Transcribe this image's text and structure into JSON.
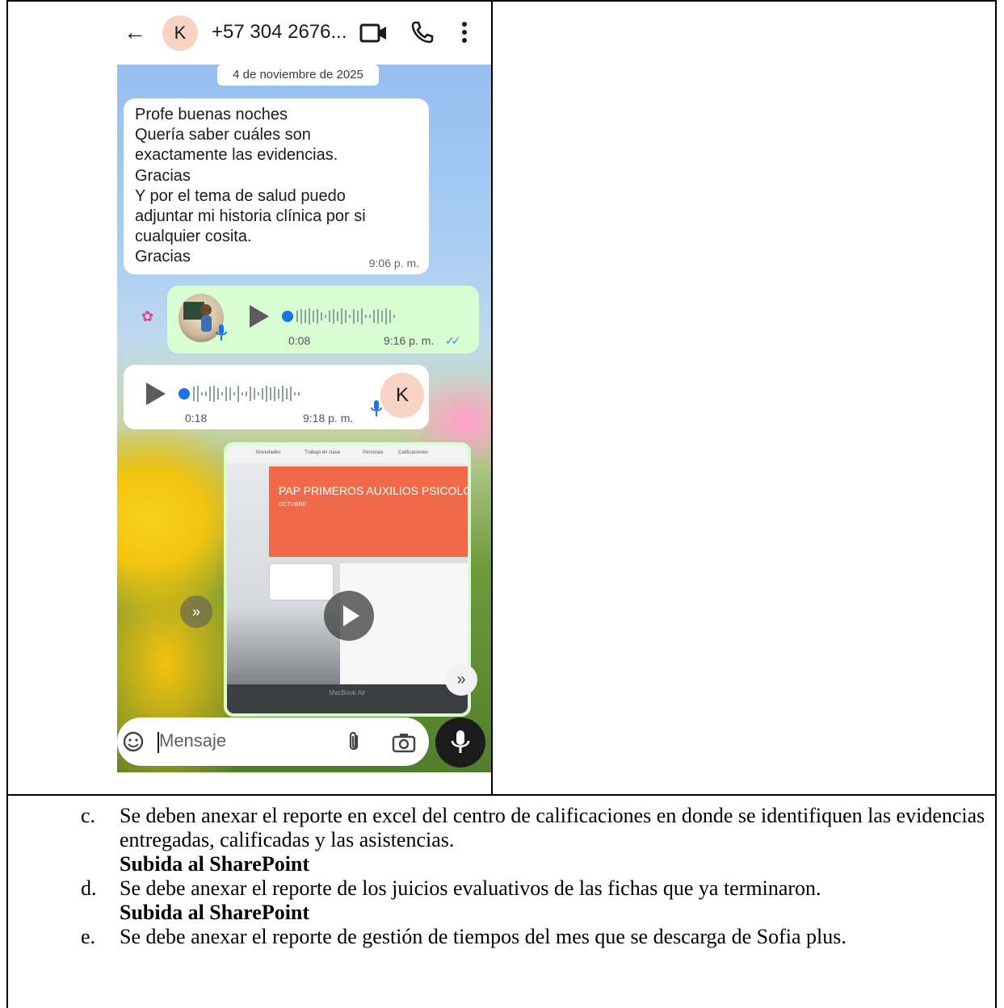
{
  "phone": {
    "header": {
      "avatar_letter": "K",
      "contact": "+57 304 2676...",
      "icons": [
        "back-arrow-icon",
        "video-call-icon",
        "phone-call-icon",
        "more-vert-icon"
      ]
    },
    "date_chip": "4 de noviembre de 2025",
    "message_in": {
      "lines": [
        "Profe buenas noches",
        "Quería saber cuáles son",
        "exactamente las evidencias.",
        "Gracias",
        "Y por el tema de salud puedo",
        "adjuntar mi historia clínica por si",
        "cualquier cosita.",
        "Gracias"
      ],
      "time": "9:06 p. m."
    },
    "audio_out": {
      "duration": "0:08",
      "time": "9:16 p. m.",
      "ticks": "✓✓"
    },
    "audio_in": {
      "duration": "0:18",
      "time": "9:18 p. m.",
      "avatar_letter": "K"
    },
    "video": {
      "tabs": [
        "Novedades",
        "Trabajo en clase",
        "Personas",
        "Calificaciones"
      ],
      "banner_title": "PAP PRIMEROS AUXILIOS PSICOLO",
      "banner_sub": "OCTUBRE",
      "laptop_label": "MacBook Air"
    },
    "composer": {
      "placeholder": "Mensaje"
    },
    "colors": {
      "outgoing_bubble": "#d9fdd3",
      "incoming_bubble": "#ffffff",
      "accent_blue": "#1a73e8"
    }
  },
  "document": {
    "items": [
      {
        "marker": "c.",
        "text": "Se deben anexar el reporte en excel del centro de calificaciones en donde se identifiquen las evidencias entregadas, calificadas y las asistencias.",
        "bold": "Subida al SharePoint"
      },
      {
        "marker": "d.",
        "text": "Se debe anexar el reporte de los juicios evaluativos de las fichas que ya terminaron.",
        "bold": "Subida al SharePoint"
      },
      {
        "marker": "e.",
        "text": "Se debe anexar el reporte de gestión de tiempos del mes que se descarga de Sofia plus.",
        "bold": ""
      }
    ]
  }
}
